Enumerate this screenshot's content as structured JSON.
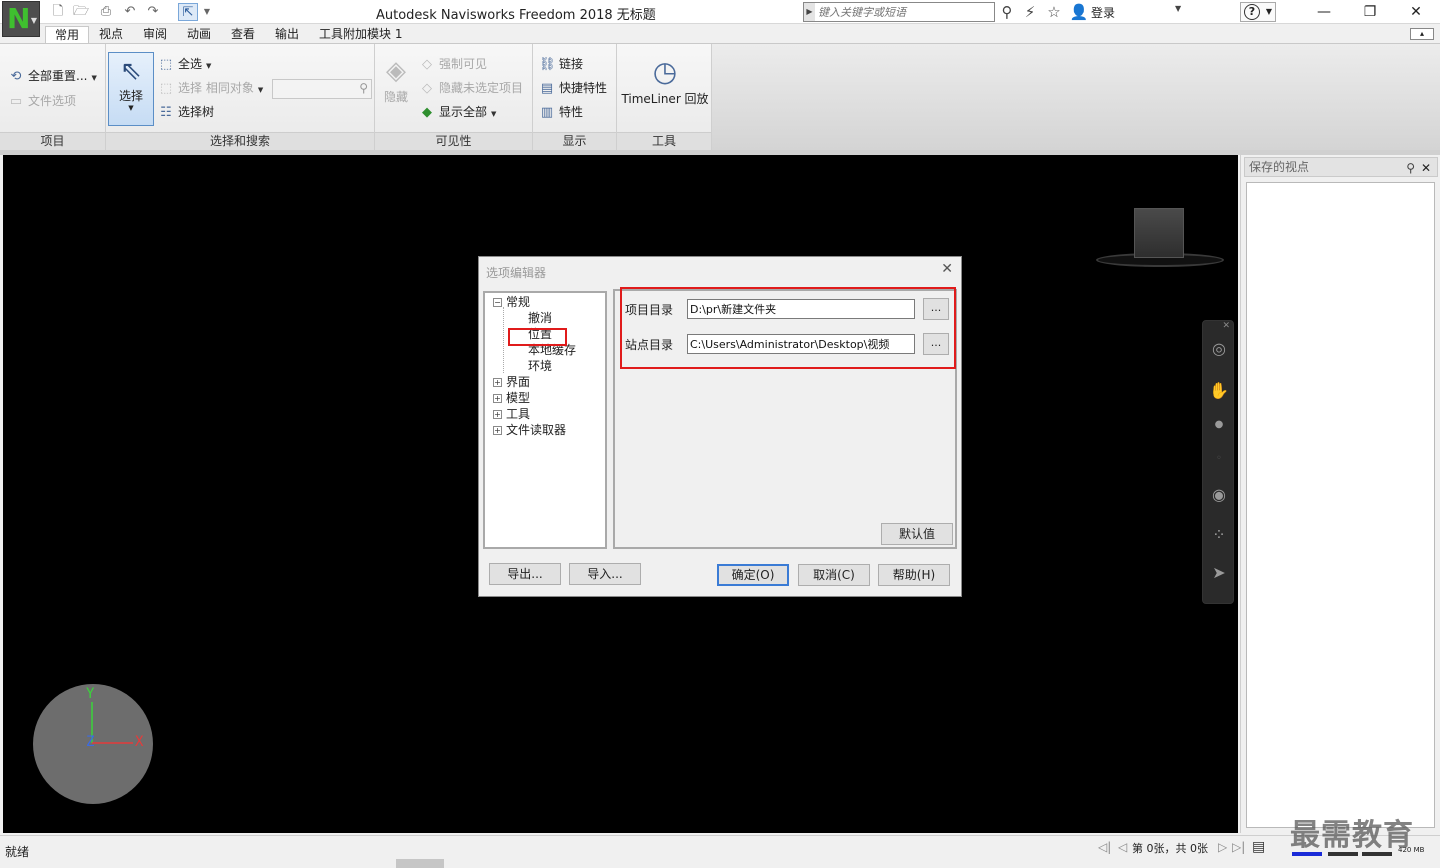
{
  "window": {
    "title": "Autodesk Navisworks Freedom 2018    无标题",
    "app_letter": "N",
    "search_placeholder": "键入关键字或短语",
    "login_label": "登录"
  },
  "ribbon": {
    "tabs": [
      "常用",
      "视点",
      "审阅",
      "动画",
      "查看",
      "输出",
      "工具附加模块 1"
    ],
    "active_tab": 0,
    "panels": {
      "project": {
        "label": "项目",
        "reset_all": "全部重置...",
        "file_options": "文件选项"
      },
      "select_search": {
        "label": "选择和搜索",
        "select": "选择",
        "select_all": "全选",
        "select_same": "选择 相同对象",
        "selection_tree": "选择树"
      },
      "visibility": {
        "label": "可见性",
        "hide": "隐藏",
        "require": "强制可见",
        "hide_unselected": "隐藏未选定项目",
        "unhide_all": "显示全部"
      },
      "display": {
        "label": "显示",
        "links": "链接",
        "quick_properties": "快捷特性",
        "properties": "特性"
      },
      "tools": {
        "label": "工具",
        "timeliner": "TimeLiner 回放"
      }
    }
  },
  "axis": {
    "x": "X",
    "y": "Y",
    "z": "Z",
    "colors": {
      "x": "#e53b3b",
      "y": "#3bd43b",
      "z": "#3b6be5"
    }
  },
  "right_panel": {
    "title": "保存的视点"
  },
  "status_bar": {
    "status": "就绪",
    "page_count": "第 0张，共 0张",
    "memory": "420 MB",
    "watermark": "最需教育"
  },
  "dialog": {
    "title": "选项编辑器",
    "tree": [
      {
        "label": "常规",
        "expander": "⊟",
        "children": [
          "撤消",
          "位置",
          "本地缓存",
          "环境"
        ]
      },
      {
        "label": "界面",
        "expander": "⊞"
      },
      {
        "label": "模型",
        "expander": "⊞"
      },
      {
        "label": "工具",
        "expander": "⊞"
      },
      {
        "label": "文件读取器",
        "expander": "⊞"
      }
    ],
    "selected_node": "位置",
    "fields": {
      "project_dir_label": "项目目录",
      "project_dir_value": "D:\\pr\\新建文件夹",
      "site_dir_label": "站点目录",
      "site_dir_value": "C:\\Users\\Administrator\\Desktop\\视频",
      "browse": "..."
    },
    "buttons": {
      "defaults": "默认值",
      "export": "导出...",
      "import": "导入...",
      "ok": "确定(O)",
      "cancel": "取消(C)",
      "help": "帮助(H)"
    },
    "highlight_color": "#e01b1b"
  }
}
